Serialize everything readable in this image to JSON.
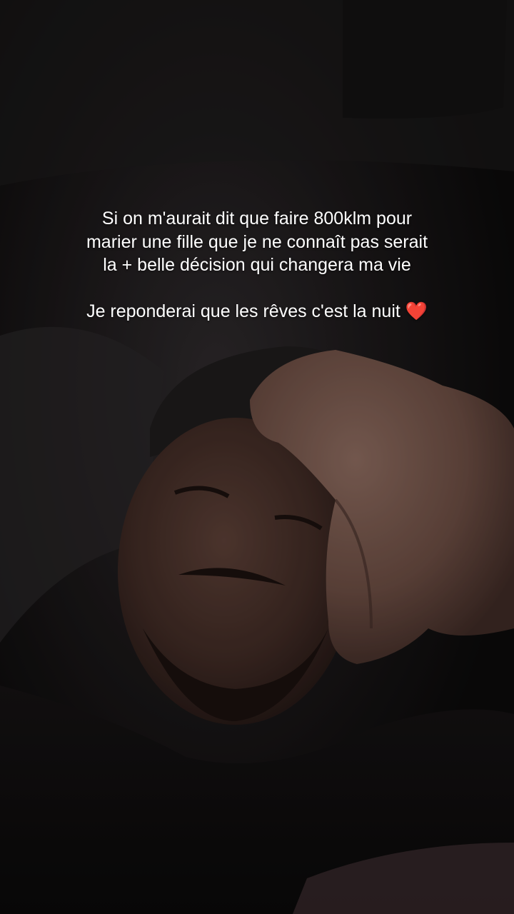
{
  "caption": {
    "lines": [
      "Si on m'aurait dit que faire 800klm pour",
      "marier une fille que je ne connaît pas serait",
      "la + belle décision qui changera ma vie",
      "Je reponderai que les rêves c'est la nuit"
    ],
    "emoji": "❤️"
  },
  "colors": {
    "background": "#0f0d0e",
    "text": "#ffffff",
    "heart": "#e0202e"
  }
}
